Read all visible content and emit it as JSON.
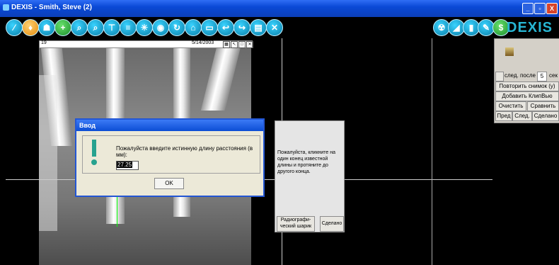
{
  "window": {
    "title": "DEXIS - Smith, Steve (2)",
    "minimize": "_",
    "maximize": "▫",
    "close": "X"
  },
  "toolbar": {
    "buttons": [
      {
        "name": "pen-tool-icon",
        "glyph": "⁄"
      },
      {
        "name": "tooth-icon",
        "glyph": "♦"
      },
      {
        "name": "patient-icon",
        "glyph": "☗"
      },
      {
        "name": "add-icon",
        "glyph": "+"
      },
      {
        "name": "zoom-in-icon",
        "glyph": "⌕"
      },
      {
        "name": "zoom-icon",
        "glyph": "⌕"
      },
      {
        "name": "measure-icon",
        "glyph": "⊤"
      },
      {
        "name": "notes-icon",
        "glyph": "≡"
      },
      {
        "name": "brightness-icon",
        "glyph": "✳"
      },
      {
        "name": "view-icon",
        "glyph": "◉"
      },
      {
        "name": "rotate-icon",
        "glyph": "↻"
      },
      {
        "name": "home-icon",
        "glyph": "⌂"
      },
      {
        "name": "open-folder-icon",
        "glyph": "▭"
      },
      {
        "name": "back-icon",
        "glyph": "↩"
      },
      {
        "name": "forward-icon",
        "glyph": "↪"
      },
      {
        "name": "print-icon",
        "glyph": "▤"
      },
      {
        "name": "close-icon",
        "glyph": "✕"
      }
    ],
    "right_buttons": [
      {
        "name": "radiation-icon",
        "glyph": "☢"
      },
      {
        "name": "eraser-icon",
        "glyph": "◢"
      },
      {
        "name": "sensor-icon",
        "glyph": "▮"
      },
      {
        "name": "pencil-icon",
        "glyph": "✎"
      },
      {
        "name": "dollar-icon",
        "glyph": "$"
      }
    ],
    "logo": "DEXIS"
  },
  "image": {
    "number": "19",
    "date": "5/14/2003"
  },
  "right_panel": {
    "after_label": "след. после",
    "after_value": "5",
    "sec": "сек",
    "repeat": "Повторить снимок (у)",
    "add_clip": "Добавить КлипВью",
    "clear": "Очистить",
    "compare": "Сравнить",
    "prev": "Пред",
    "next": "След.",
    "done": "Сделано"
  },
  "dialog": {
    "title": "Ввод",
    "message": "Пожалуйста введите истинную длину расстояния (в мм):",
    "value": "27.25",
    "ok": "OK"
  },
  "instruction": {
    "text": "Пожалуйста, кликните на один конец известной длины и протяните до другого конца.",
    "radiographic": "Радиографи-ческий шарик",
    "done": "Сделано"
  }
}
